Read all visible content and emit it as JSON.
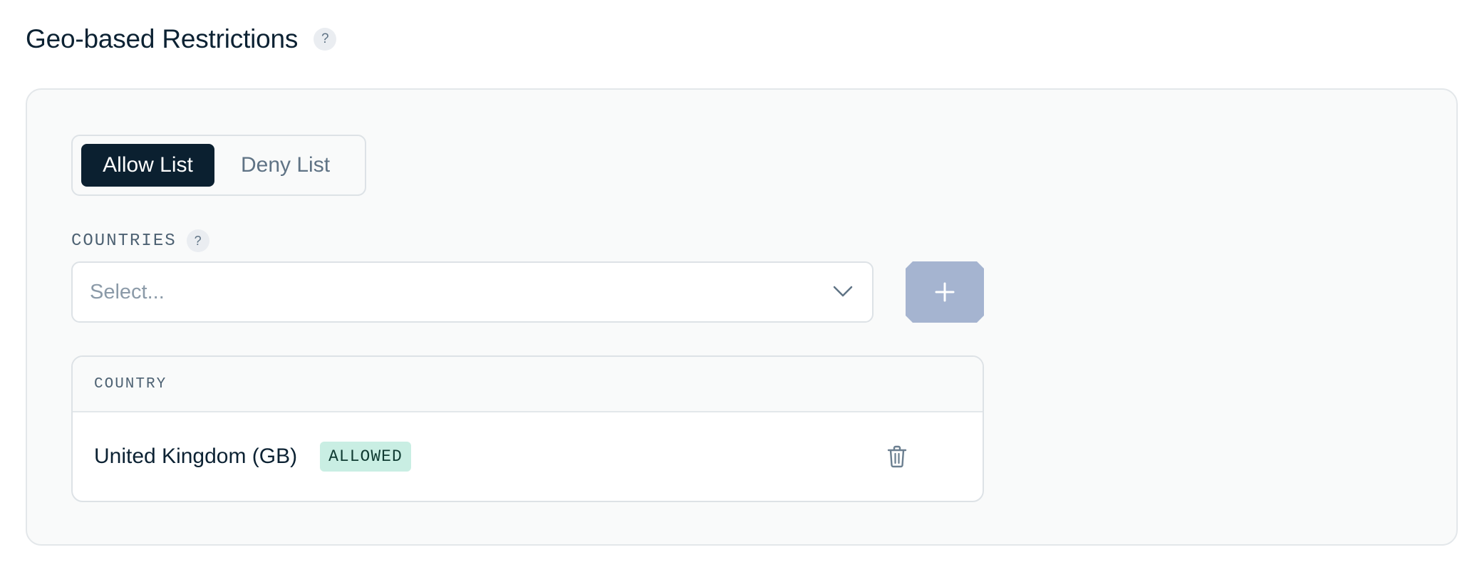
{
  "header": {
    "title": "Geo-based Restrictions",
    "help_symbol": "?"
  },
  "mode_toggle": {
    "options": [
      "Allow List",
      "Deny List"
    ],
    "selected": "Allow List"
  },
  "countries_field": {
    "label": "COUNTRIES",
    "help_symbol": "?",
    "placeholder": "Select...",
    "dropdown_icon": "chevron-down-icon",
    "add_icon": "plus-icon"
  },
  "table": {
    "column_header": "COUNTRY",
    "rows": [
      {
        "country": "United Kingdom (GB)",
        "status": "ALLOWED",
        "action_icon": "trash-icon"
      }
    ]
  },
  "colors": {
    "primary_dark": "#0b2030",
    "add_button_disabled": "#a5b4d0",
    "allowed_badge_bg": "#c9eee3",
    "panel_bg": "#f9fafa",
    "border": "#dde2e6"
  }
}
